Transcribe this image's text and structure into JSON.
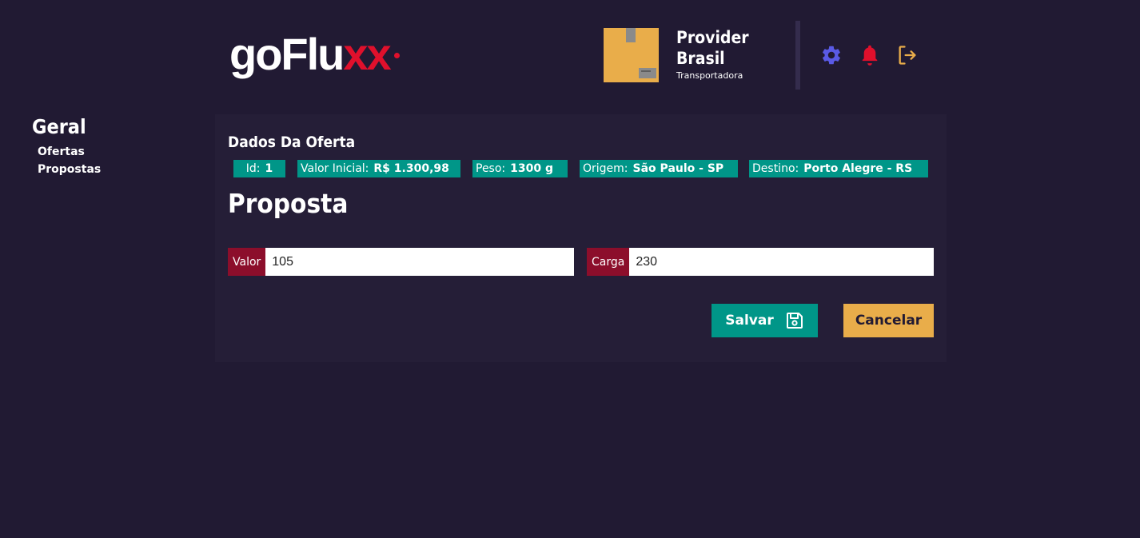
{
  "brand": {
    "logo_main": "goFlu",
    "logo_accent": "xx"
  },
  "header": {
    "user_name": "Provider Brasil",
    "user_role": "Transportadora",
    "icons": [
      "gear-icon",
      "bell-icon",
      "logout-icon"
    ],
    "colors": {
      "settings": "#5a5ae6",
      "bell": "#e0102c",
      "logout": "#e9ad4a"
    }
  },
  "sidebar": {
    "title": "Geral",
    "items": [
      {
        "label": "Ofertas"
      },
      {
        "label": "Propostas"
      }
    ]
  },
  "offer": {
    "section_title": "Dados Da Oferta",
    "fields": [
      {
        "label": "Id:",
        "value": "1"
      },
      {
        "label": "Valor Inicial:",
        "value": "R$ 1.300,98"
      },
      {
        "label": "Peso:",
        "value": "1300 g"
      },
      {
        "label": "Origem:",
        "value": "São Paulo - SP"
      },
      {
        "label": "Destino:",
        "value": "Porto Alegre - RS"
      }
    ]
  },
  "proposal": {
    "heading": "Proposta",
    "valor_label": "Valor",
    "valor_value": "105",
    "carga_label": "Carga",
    "carga_value": "230",
    "save_label": "Salvar",
    "cancel_label": "Cancelar"
  },
  "colors": {
    "background": "#211a33",
    "card": "#251e37",
    "chip": "#009688",
    "prefix": "#8c0e2b",
    "save": "#009688",
    "cancel": "#e9ad4a"
  }
}
